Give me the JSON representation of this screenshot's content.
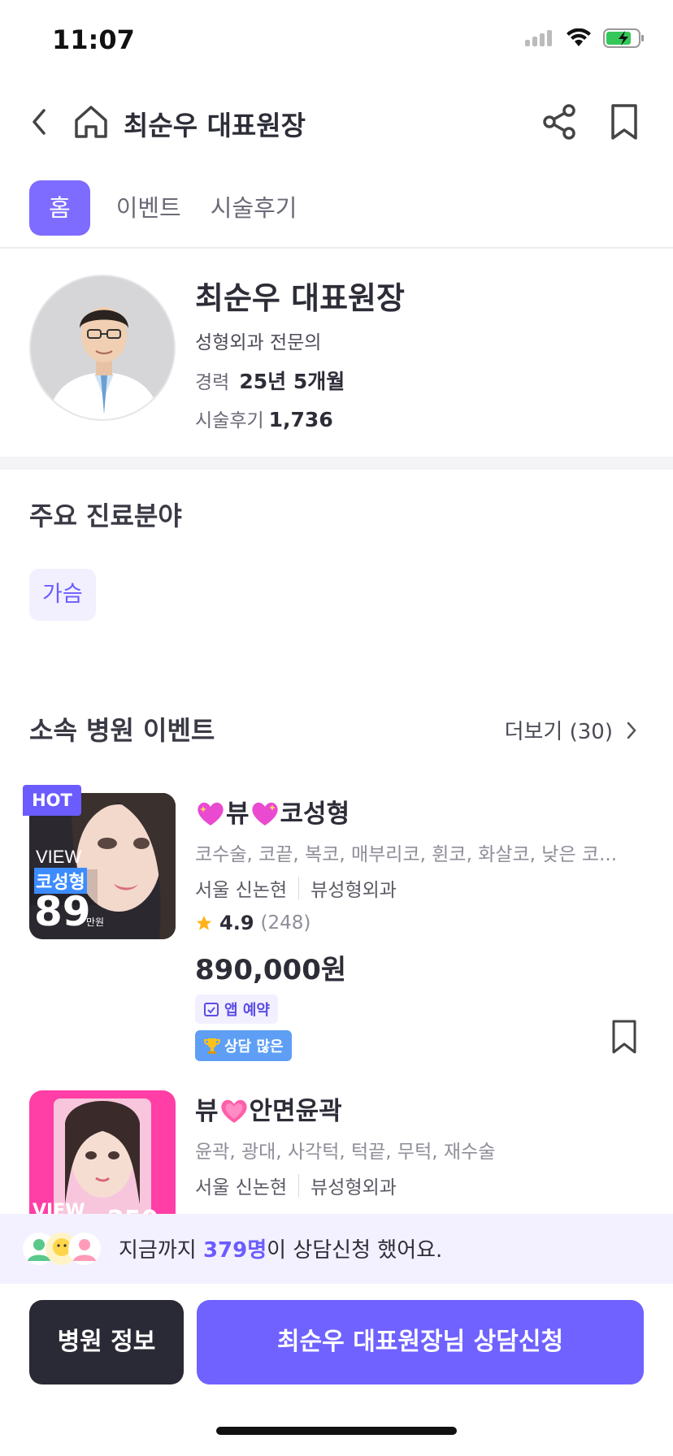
{
  "status": {
    "time": "11:07"
  },
  "header": {
    "title": "최순우 대표원장"
  },
  "tabs": [
    {
      "label": "홈",
      "active": true
    },
    {
      "label": "이벤트",
      "active": false
    },
    {
      "label": "시술후기",
      "active": false
    }
  ],
  "profile": {
    "name": "최순우 대표원장",
    "specialty": "성형외과 전문의",
    "career_label": "경력",
    "career_value": "25년 5개월",
    "review_label": "시술후기",
    "review_count": "1,736"
  },
  "specialties": {
    "title": "주요 진료분야",
    "chips": [
      "가슴"
    ]
  },
  "events_section": {
    "title": "소속 병원 이벤트",
    "more_label": "더보기 (30)"
  },
  "events": [
    {
      "hot": "HOT",
      "title_prefix": "뷰",
      "title_suffix": "코성형",
      "tags": "코수술, 코끝, 복코, 매부리코, 휜코, 화살코, 낮은 코...",
      "location": "서울 신논현",
      "clinic": "뷰성형외과",
      "rating": "4.9",
      "review_count": "(248)",
      "price": "890,000원",
      "app_badge": "앱 예약",
      "consult_badge": "상담 많은",
      "thumb_text1": "VIEW",
      "thumb_text2": "코성형",
      "thumb_text3": "89",
      "thumb_text4": "만원"
    },
    {
      "title_prefix": "뷰",
      "title_suffix": "안면윤곽",
      "tags": "윤곽, 광대, 사각턱, 턱끝, 무턱, 재수술",
      "location": "서울 신논현",
      "clinic": "뷰성형외과",
      "thumb_text1": "VIEW",
      "thumb_text2": "250"
    }
  ],
  "banner": {
    "prefix": "지금까지 ",
    "count": "379명",
    "suffix": "이 상담신청 했어요."
  },
  "bottom": {
    "info_button": "병원 정보",
    "consult_button": "최순우 대표원장님 상담신청"
  },
  "colors": {
    "accent": "#6f62ff",
    "dark": "#2a2a36",
    "chip_bg": "#f2f0ff"
  }
}
